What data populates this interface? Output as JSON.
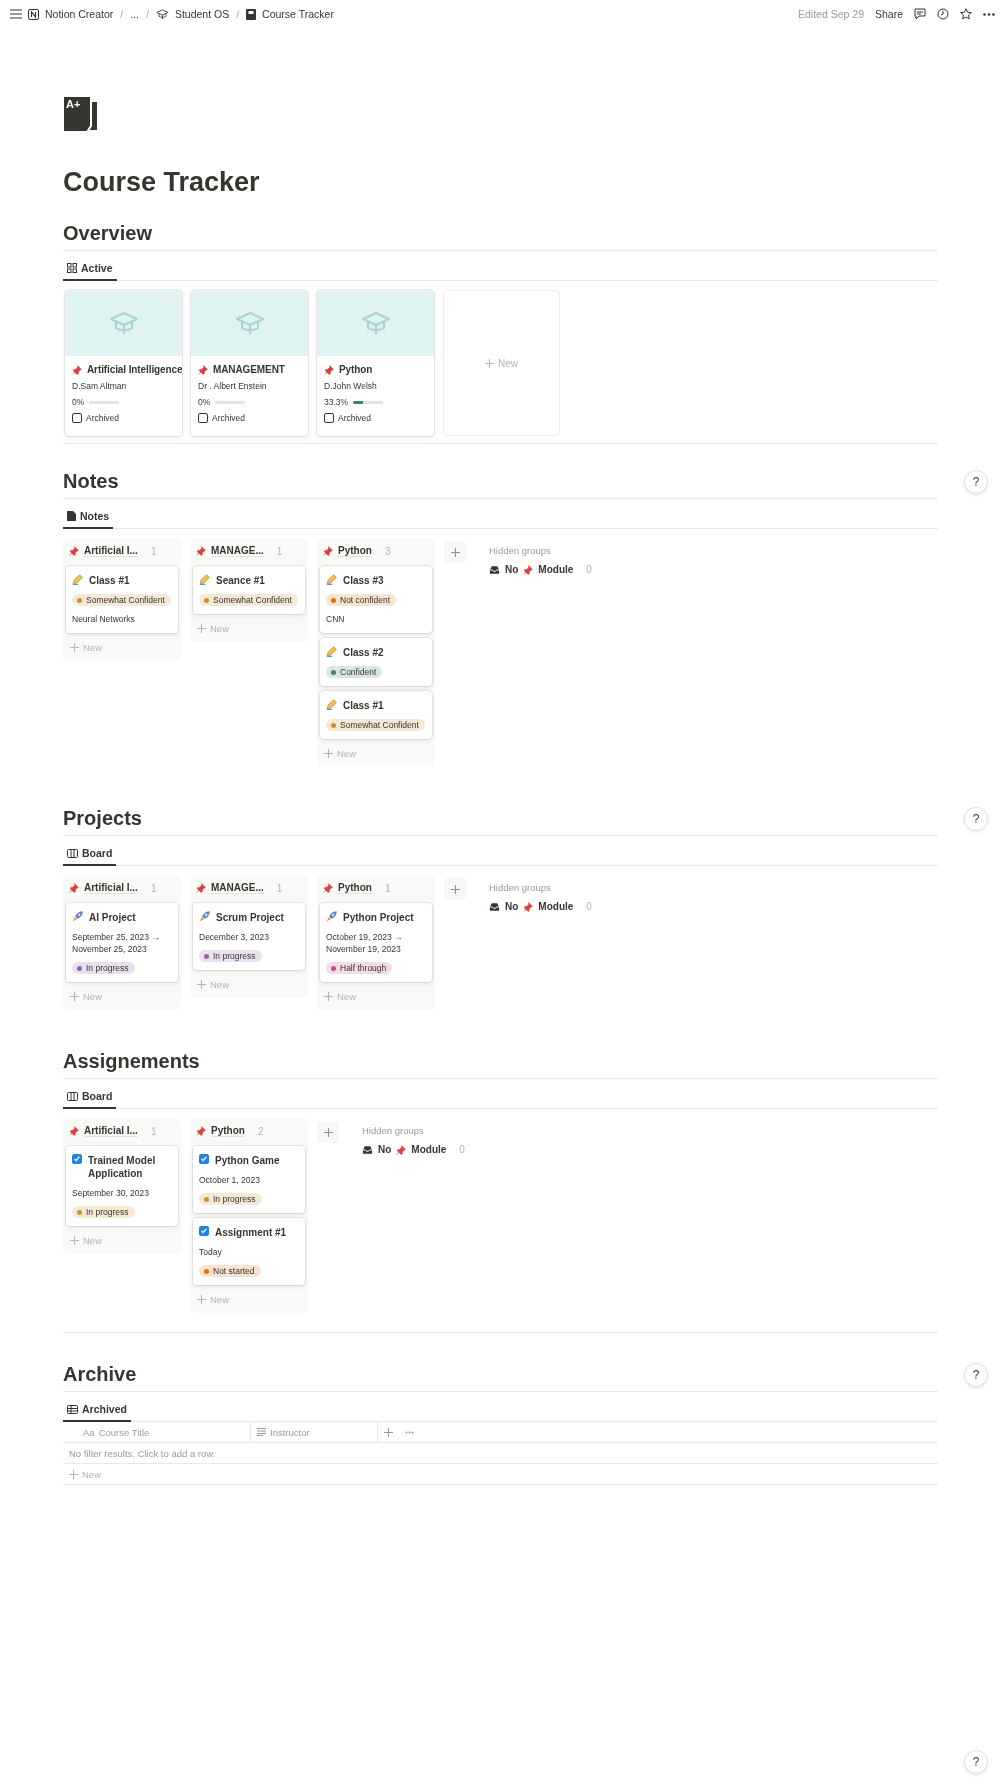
{
  "topbar": {
    "separator": "/",
    "crumbs": [
      {
        "label": "Notion Creator"
      },
      {
        "label": "..."
      },
      {
        "label": "Student OS"
      },
      {
        "label": "Course Tracker"
      }
    ],
    "edited": "Edited Sep 29",
    "share": "Share"
  },
  "page": {
    "icon_label": "A+",
    "title": "Course Tracker",
    "help": "?"
  },
  "sections": [
    {
      "kind": "gallery",
      "heading": "Overview",
      "views": [
        {
          "kind": "gallery",
          "label": "Active",
          "selected": true
        }
      ],
      "new_label": "New",
      "cards": [
        {
          "title": "Artificial Intelligence",
          "instructor": "D.Sam Altman",
          "progress": "0%",
          "level": 0,
          "archived": false,
          "archived_label": "Archived"
        },
        {
          "title": "MANAGEMENT",
          "instructor": "Dr . Albert Enstein",
          "progress": "0%",
          "level": 0,
          "archived": false,
          "archived_label": "Archived"
        },
        {
          "title": "Python",
          "instructor": "D.John Welsh",
          "progress": "33.3%",
          "level": 0.333,
          "archived": false,
          "archived_label": "Archived"
        }
      ]
    },
    {
      "kind": "board",
      "heading": "Notes",
      "help": "?",
      "views": [
        {
          "kind": "page",
          "label": "Notes",
          "selected": true
        }
      ],
      "hidden_label": "Hidden groups",
      "hidden_groups": [
        {
          "no": "No",
          "module": "Module",
          "count": "0"
        }
      ],
      "groups": [
        {
          "title": "Artificial I...",
          "count": "1",
          "new_label": "New",
          "cards": [
            {
              "kind": "note",
              "title": "Class #1",
              "tag": {
                "label": "Somewhat Confident",
                "color": "#cb912f"
              },
              "text": "Neural Networks"
            }
          ]
        },
        {
          "title": "MANAGE...",
          "count": "1",
          "new_label": "New",
          "cards": [
            {
              "kind": "note",
              "title": "Seance #1",
              "tag": {
                "label": "Somewhat Confident",
                "color": "#cb912f"
              }
            }
          ]
        },
        {
          "title": "Python",
          "count": "3",
          "new_label": "New",
          "cards": [
            {
              "kind": "note",
              "title": "Class #3",
              "tag": {
                "label": "Not confident",
                "color": "#d9730d"
              },
              "text": "CNN"
            },
            {
              "kind": "note",
              "title": "Class #2",
              "tag": {
                "label": "Confident",
                "color": "#448361"
              }
            },
            {
              "kind": "note",
              "title": "Class #1",
              "tag": {
                "label": "Somewhat Confident",
                "color": "#cb912f"
              }
            }
          ]
        }
      ]
    },
    {
      "kind": "board",
      "heading": "Projects",
      "help": "?",
      "views": [
        {
          "kind": "board",
          "label": "Board",
          "selected": true
        }
      ],
      "hidden_label": "Hidden groups",
      "hidden_groups": [
        {
          "no": "No",
          "module": "Module",
          "count": "0"
        }
      ],
      "groups": [
        {
          "title": "Artificial I...",
          "count": "1",
          "new_label": "New",
          "cards": [
            {
              "kind": "project",
              "title": "AI Project",
              "text": "September 25, 2023 → November 25, 2023",
              "tag": {
                "label": "In progress",
                "color": "#9065b0"
              }
            }
          ]
        },
        {
          "title": "MANAGE...",
          "count": "1",
          "new_label": "New",
          "cards": [
            {
              "kind": "project",
              "title": "Scrum Project",
              "text": "December 3, 2023",
              "tag": {
                "label": "In progress",
                "color": "#9065b0"
              }
            }
          ]
        },
        {
          "title": "Python",
          "count": "1",
          "new_label": "New",
          "cards": [
            {
              "kind": "project",
              "title": "Python Project",
              "text": "October 19, 2023 → November 19, 2023",
              "tag": {
                "label": "Half through",
                "color": "#c14c8a"
              }
            }
          ]
        }
      ]
    },
    {
      "kind": "board",
      "heading": "Assignements",
      "views": [
        {
          "kind": "board",
          "label": "Board",
          "selected": true
        }
      ],
      "hidden_label": "Hidden groups",
      "hidden_groups": [
        {
          "no": "No",
          "module": "Module",
          "count": "0"
        }
      ],
      "groups": [
        {
          "title": "Artificial I...",
          "count": "1",
          "new_label": "New",
          "cards": [
            {
              "kind": "task",
              "checked": true,
              "title": "Trained Model Application",
              "text": "September 30, 2023",
              "tag": {
                "label": "In progress",
                "color": "#cb912f"
              }
            }
          ]
        },
        {
          "title": "Python",
          "count": "2",
          "new_label": "New",
          "cards": [
            {
              "kind": "task",
              "checked": true,
              "title": "Python Game",
              "text": "October 1, 2023",
              "tag": {
                "label": "In progress",
                "color": "#cb912f"
              }
            },
            {
              "kind": "task",
              "checked": true,
              "title": "Assignment #1",
              "text": "Today",
              "tag": {
                "label": "Not started",
                "color": "#d9730d"
              }
            }
          ]
        }
      ]
    },
    {
      "kind": "table",
      "heading": "Archive",
      "help": "?",
      "views": [
        {
          "kind": "table",
          "label": "Archived",
          "selected": true
        }
      ],
      "columns": [
        {
          "prefix": "Aa",
          "label": "Course Title"
        },
        {
          "label": "Instructor"
        }
      ],
      "empty": "No filter results. Click to add a row.",
      "new_label": "New"
    }
  ]
}
